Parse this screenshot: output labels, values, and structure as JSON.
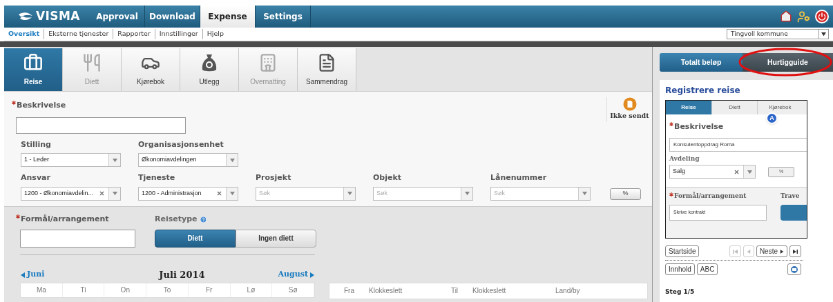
{
  "top_nav": {
    "logo": "VISMA",
    "tabs": [
      {
        "label": "Approval",
        "selected": false
      },
      {
        "label": "Download",
        "selected": false
      },
      {
        "label": "Expense",
        "selected": true
      },
      {
        "label": "Settings",
        "selected": false
      }
    ]
  },
  "sub_nav": {
    "items": [
      {
        "label": "Oversikt",
        "selected": true
      },
      {
        "label": "Eksterne tjenester",
        "selected": false
      },
      {
        "label": "Rapporter",
        "selected": false
      },
      {
        "label": "Innstillinger",
        "selected": false
      },
      {
        "label": "Hjelp",
        "selected": false
      }
    ],
    "organization": "Tingvoll kommune"
  },
  "steps": [
    {
      "kind": "travel",
      "label": "Reise",
      "selected": true,
      "disabled": false
    },
    {
      "kind": "meals",
      "label": "Diett",
      "selected": false,
      "disabled": true
    },
    {
      "kind": "mileage",
      "label": "Kjørebok",
      "selected": false,
      "disabled": false
    },
    {
      "kind": "expense",
      "label": "Utlegg",
      "selected": false,
      "disabled": false
    },
    {
      "kind": "lodging",
      "label": "Overnatting",
      "selected": false,
      "disabled": true
    },
    {
      "kind": "summary",
      "label": "Sammendrag",
      "selected": false,
      "disabled": false
    }
  ],
  "form": {
    "description": {
      "label": "Beskrivelse",
      "required": true
    },
    "status": "Ikke sendt",
    "rows": [
      [
        {
          "label": "Stilling",
          "value": "1 - Leder",
          "clearable": false
        },
        {
          "label": "Organisasjonsenhet",
          "value": "Økonomiavdelingen",
          "clearable": false
        }
      ],
      [
        {
          "label": "Ansvar",
          "value": "1200 - Økonomiavdelin...",
          "clearable": true
        },
        {
          "label": "Tjeneste",
          "value": "1200 - Administrasjon",
          "clearable": true
        },
        {
          "label": "Prosjekt",
          "placeholder": "Søk",
          "clearable": false
        },
        {
          "label": "Objekt",
          "placeholder": "Søk",
          "clearable": false
        },
        {
          "label": "Lånenummer",
          "placeholder": "Søk",
          "clearable": false
        }
      ]
    ],
    "split_button": "%"
  },
  "purpose": {
    "label": "Formål/arrangement",
    "required": true
  },
  "travel_type": {
    "label": "Reisetype",
    "options": [
      {
        "label": "Diett",
        "selected": true
      },
      {
        "label": "Ingen diett",
        "selected": false
      }
    ]
  },
  "calendar": {
    "previous": "Juni",
    "title": "Juli 2014",
    "next": "August",
    "weekdays": [
      "Ma",
      "Ti",
      "On",
      "To",
      "Fr",
      "Lø",
      "Sø"
    ]
  },
  "trip_table": {
    "columns": [
      "Fra",
      "Klokkeslett",
      "Til",
      "Klokkeslett",
      "Land/by"
    ]
  },
  "side_panel": {
    "tabs": [
      {
        "label": "Totalt beløp",
        "selected": false
      },
      {
        "label": "Hurtigguide",
        "selected": true,
        "circled": true
      }
    ],
    "title": "Registrere reise",
    "guide_image": {
      "tabs": [
        {
          "label": "Reise",
          "selected": true
        },
        {
          "label": "Diett",
          "selected": false
        },
        {
          "label": "Kjørebok",
          "selected": false
        }
      ],
      "marker": "A",
      "description_label": "Beskrivelse",
      "description_value": "Konsulentoppdrag Roma",
      "department_label": "Avdeling",
      "department_value": "Salg",
      "split_button": "%",
      "purpose_label": "Formål/arrangement",
      "purpose_value": "Skrive kontrakt",
      "column_2_label": "Trave"
    },
    "nav_buttons": [
      {
        "kind": "text",
        "label": "Startside",
        "disabled": false
      },
      {
        "kind": "first",
        "disabled": true
      },
      {
        "kind": "prev",
        "disabled": true
      },
      {
        "kind": "next",
        "label": "Neste",
        "disabled": false
      },
      {
        "kind": "last",
        "disabled": false
      }
    ],
    "tool_buttons": [
      {
        "kind": "text",
        "label": "Innhold"
      },
      {
        "kind": "text",
        "label": "ABC"
      },
      {
        "kind": "print"
      }
    ],
    "step": "Steg 1/5"
  }
}
